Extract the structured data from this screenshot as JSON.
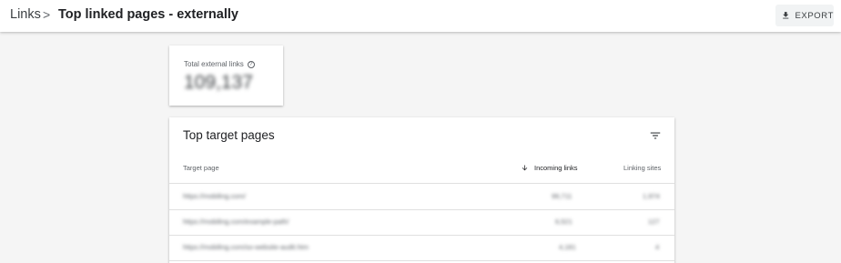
{
  "header": {
    "breadcrumb_root": "Links",
    "breadcrumb_separator": ">",
    "page_title": "Top linked pages - externally",
    "export_label": "EXPORT"
  },
  "stat_card": {
    "label": "Total external links",
    "value": "109,137"
  },
  "table": {
    "title": "Top target pages",
    "columns": [
      "Target page",
      "Incoming links",
      "Linking sites"
    ],
    "sort_column": "Incoming links",
    "rows": [
      {
        "page": "https://mobiling.com/",
        "incoming": "99,711",
        "sites": "1,974"
      },
      {
        "page": "https://mobiling.com/example-path/",
        "incoming": "6,521",
        "sites": "127"
      },
      {
        "page": "https://mobiling.com/so-website-audit.htm",
        "incoming": "4,181",
        "sites": "4"
      }
    ]
  },
  "icons": {
    "export": "download-icon",
    "help": "help-circle-icon",
    "filter": "filter-icon",
    "sort": "arrow-down-icon"
  },
  "colors": {
    "background": "#f5f5f5",
    "card": "#ffffff",
    "text_primary": "#202124",
    "text_secondary": "#5f6368"
  }
}
